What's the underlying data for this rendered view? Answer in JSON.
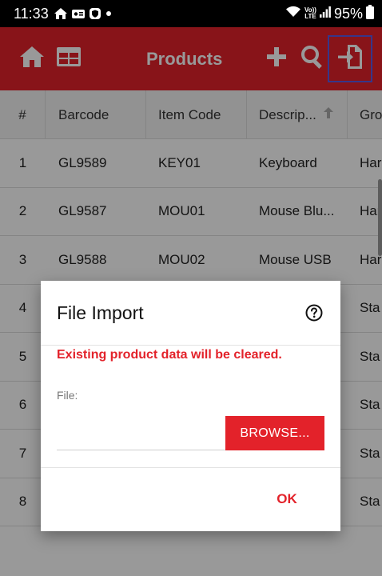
{
  "status_bar": {
    "time": "11:33",
    "battery": "95%",
    "network_label": "LTE",
    "network_label_top": "Vo))"
  },
  "app_bar": {
    "title": "Products",
    "icons": [
      "home-icon",
      "grid-icon",
      "add-icon",
      "search-icon",
      "file-import-icon"
    ]
  },
  "table": {
    "columns": [
      "#",
      "Barcode",
      "Item Code",
      "Descrip...",
      "Gro"
    ],
    "rows": [
      {
        "num": "1",
        "barcode": "GL9589",
        "item_code": "KEY01",
        "description": "Keyboard",
        "group": "Har"
      },
      {
        "num": "2",
        "barcode": "GL9587",
        "item_code": "MOU01",
        "description": "Mouse Blu...",
        "group": "Har"
      },
      {
        "num": "3",
        "barcode": "GL9588",
        "item_code": "MOU02",
        "description": "Mouse USB",
        "group": "Har"
      },
      {
        "num": "4",
        "barcode": "",
        "item_code": "",
        "description": "",
        "group": "Sta"
      },
      {
        "num": "5",
        "barcode": "",
        "item_code": "",
        "description": "",
        "group": "Sta"
      },
      {
        "num": "6",
        "barcode": "",
        "item_code": "",
        "description": "",
        "group": "Sta"
      },
      {
        "num": "7",
        "barcode": "",
        "item_code": "",
        "description": "",
        "group": "Sta"
      },
      {
        "num": "8",
        "barcode": "",
        "item_code": "",
        "description": "",
        "group": "Sta"
      }
    ]
  },
  "dialog": {
    "title": "File Import",
    "warning": "Existing product data will be cleared.",
    "file_label": "File:",
    "file_value": "",
    "browse_label": "BROWSE...",
    "ok_label": "OK"
  },
  "colors": {
    "primary": "#e3222a",
    "highlight": "#5a5ae6"
  }
}
